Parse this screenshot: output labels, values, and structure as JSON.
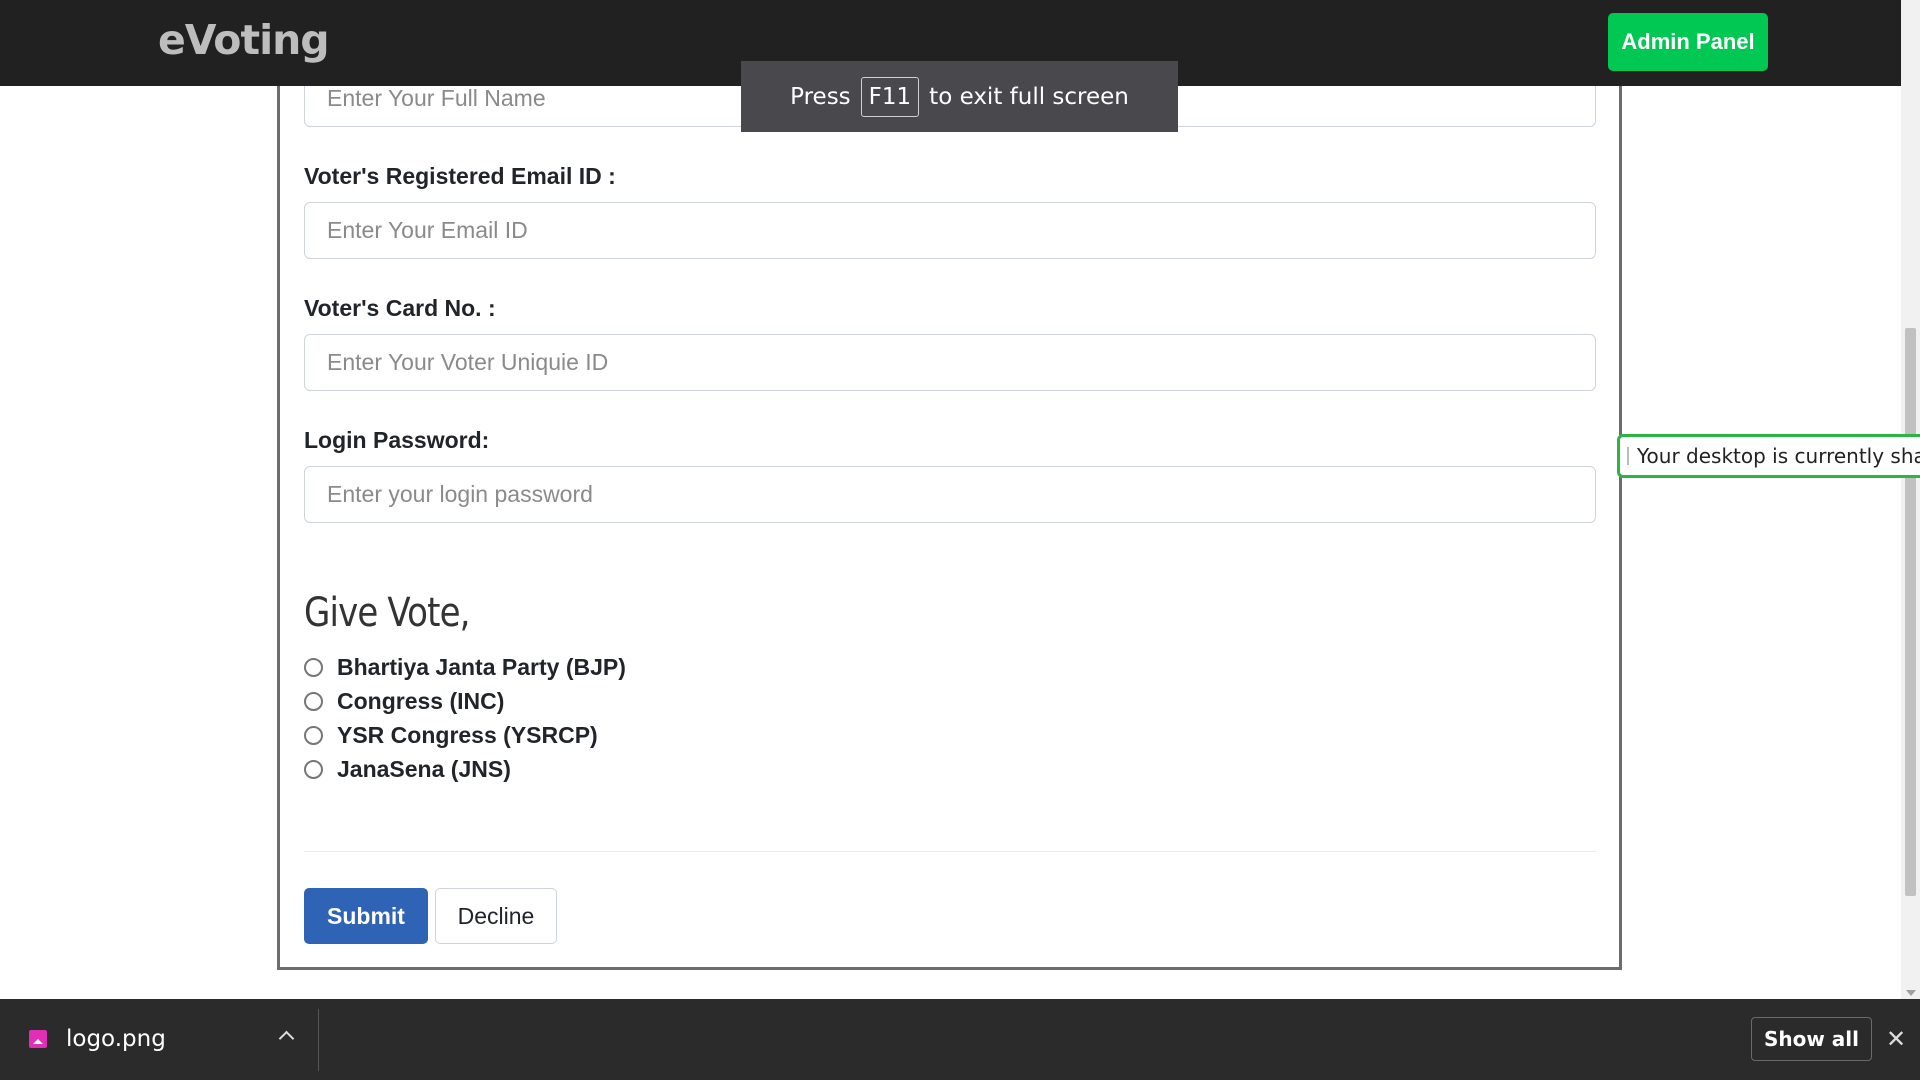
{
  "navbar": {
    "brand": "eVoting",
    "admin_label": "Admin Panel"
  },
  "form": {
    "name_placeholder": "Enter Your Full Name",
    "email_label": "Voter's Registered Email ID :",
    "email_placeholder": "Enter Your Email ID",
    "card_label": "Voter's Card No. :",
    "card_placeholder": "Enter Your Voter Uniquie ID",
    "password_label": "Login Password:",
    "password_placeholder": "Enter your login password",
    "vote_heading": "Give Vote,",
    "options": [
      "Bhartiya Janta Party (BJP)",
      "Congress (INC)",
      "YSR Congress (YSRCP)",
      "JanaSena (JNS)"
    ],
    "submit_label": "Submit",
    "decline_label": "Decline"
  },
  "fullscreen_toast": {
    "before": "Press",
    "key": "F11",
    "after": "to exit full screen"
  },
  "share_notice": {
    "text": "Your desktop is currently shared"
  },
  "download_shelf": {
    "file_name": "logo.png",
    "show_all_label": "Show all",
    "close_glyph": "✕"
  },
  "colors": {
    "navbar": "#212121",
    "admin_button": "#00c853",
    "submit_button": "#2f63b5",
    "share_border": "#2fb344",
    "file_icon": "#e02fb6"
  }
}
